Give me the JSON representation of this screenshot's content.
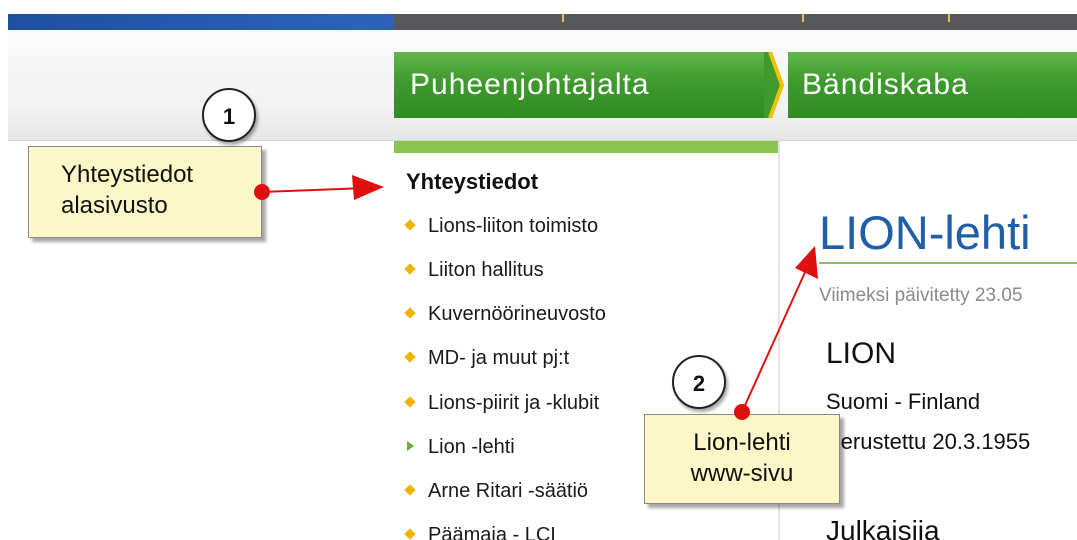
{
  "nav": {
    "tabs": [
      {
        "label": "Puheenjohtajalta"
      },
      {
        "label": "Bändiskaba"
      }
    ]
  },
  "sidebar": {
    "heading": "Yhteystiedot",
    "items": [
      {
        "label": "Lions-liiton toimisto",
        "bullet": "diamond"
      },
      {
        "label": "Liiton hallitus",
        "bullet": "diamond"
      },
      {
        "label": "Kuvernöörineuvosto",
        "bullet": "diamond"
      },
      {
        "label": "MD- ja muut pj:t",
        "bullet": "diamond"
      },
      {
        "label": "Lions-piirit ja -klubit",
        "bullet": "diamond"
      },
      {
        "label": "Lion -lehti",
        "bullet": "arrow",
        "active": true
      },
      {
        "label": "Arne Ritari -säätiö",
        "bullet": "diamond"
      },
      {
        "label": "Päämaja - LCI",
        "bullet": "diamond"
      }
    ]
  },
  "content": {
    "title": "LION-lehti",
    "updated": "Viimeksi päivitetty 23.05",
    "heading": "LION",
    "lines": [
      "Suomi - Finland",
      "Perustettu 20.3.1955"
    ],
    "subheading": "Julkaisija"
  },
  "annotations": {
    "badge_1": "1",
    "badge_2": "2",
    "callout_1": [
      "Yhteystiedot",
      "alasivusto"
    ],
    "callout_2": [
      "Lion-lehti",
      "www-sivu"
    ]
  },
  "colors": {
    "nav_green": "#3f9a2e",
    "sidebar_accent": "#8cc153",
    "title_blue": "#1f5fa6",
    "bullet_yellow": "#f0b400",
    "annotation_red": "#e01010",
    "callout_fill": "#fbf7c6"
  }
}
